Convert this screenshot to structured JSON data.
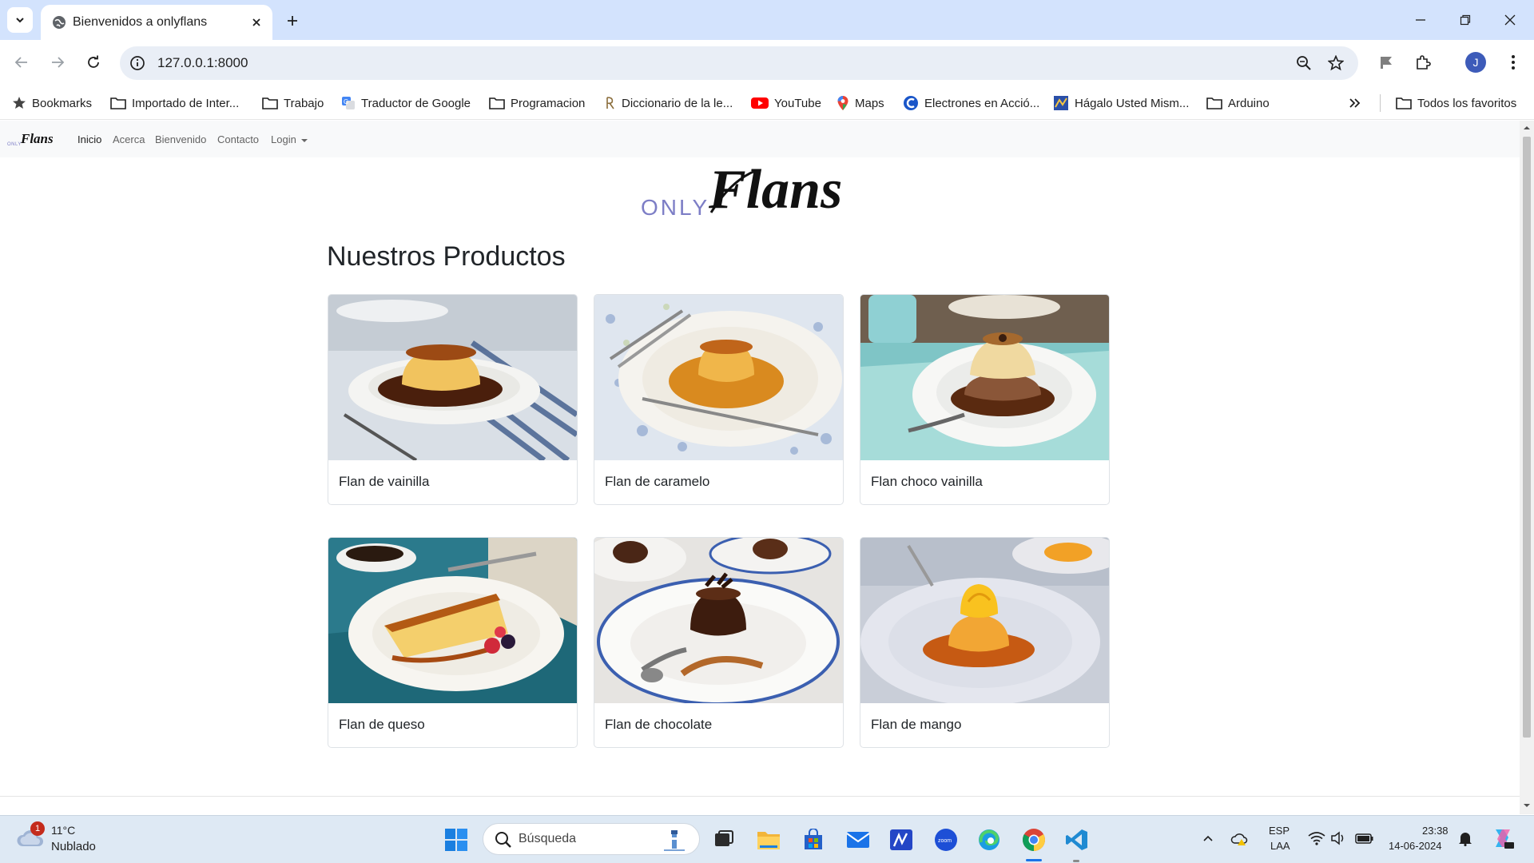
{
  "browser": {
    "tab_title": "Bienvenidos a onlyflans",
    "url": "127.0.0.1:8000",
    "avatar_initial": "J",
    "bookmarks": [
      {
        "label": "Bookmarks",
        "icon": "star-icon"
      },
      {
        "label": "Importado de Inter...",
        "icon": "folder-icon"
      },
      {
        "label": "Trabajo",
        "icon": "folder-icon"
      },
      {
        "label": "Traductor de Google",
        "icon": "google-translate-icon"
      },
      {
        "label": "Programacion",
        "icon": "folder-icon"
      },
      {
        "label": "Diccionario de la le...",
        "icon": "rae-icon"
      },
      {
        "label": "YouTube",
        "icon": "youtube-icon"
      },
      {
        "label": "Maps",
        "icon": "maps-pin-icon"
      },
      {
        "label": "Electrones en Acció...",
        "icon": "electrones-icon"
      },
      {
        "label": "Hágalo Usted Mism...",
        "icon": "hagalo-icon"
      },
      {
        "label": "Arduino",
        "icon": "folder-icon"
      }
    ],
    "all_bookmarks": "Todos los favoritos"
  },
  "site": {
    "brand_small": "ONLY",
    "brand_script": "Flans",
    "nav": {
      "inicio": "Inicio",
      "acerca": "Acerca",
      "bienvenido": "Bienvenido",
      "contacto": "Contacto",
      "login": "Login"
    },
    "hero_logo": {
      "only": "ONLY",
      "flans": "Flans"
    },
    "section_title": "Nuestros Productos",
    "products": [
      {
        "name": "Flan de vainilla"
      },
      {
        "name": "Flan de caramelo"
      },
      {
        "name": "Flan choco vainilla"
      },
      {
        "name": "Flan de queso"
      },
      {
        "name": "Flan de chocolate"
      },
      {
        "name": "Flan de mango"
      }
    ],
    "colors": {
      "brand_only": "#7d7ec6",
      "navbar_bg": "#f8f9fa",
      "card_border": "#dee2e6"
    }
  },
  "taskbar": {
    "weather_temp": "11°C",
    "weather_desc": "Nublado",
    "weather_badge": "1",
    "search_placeholder": "Búsqueda",
    "lang_line1": "ESP",
    "lang_line2": "LAA",
    "time": "23:38",
    "date": "14-06-2024"
  }
}
